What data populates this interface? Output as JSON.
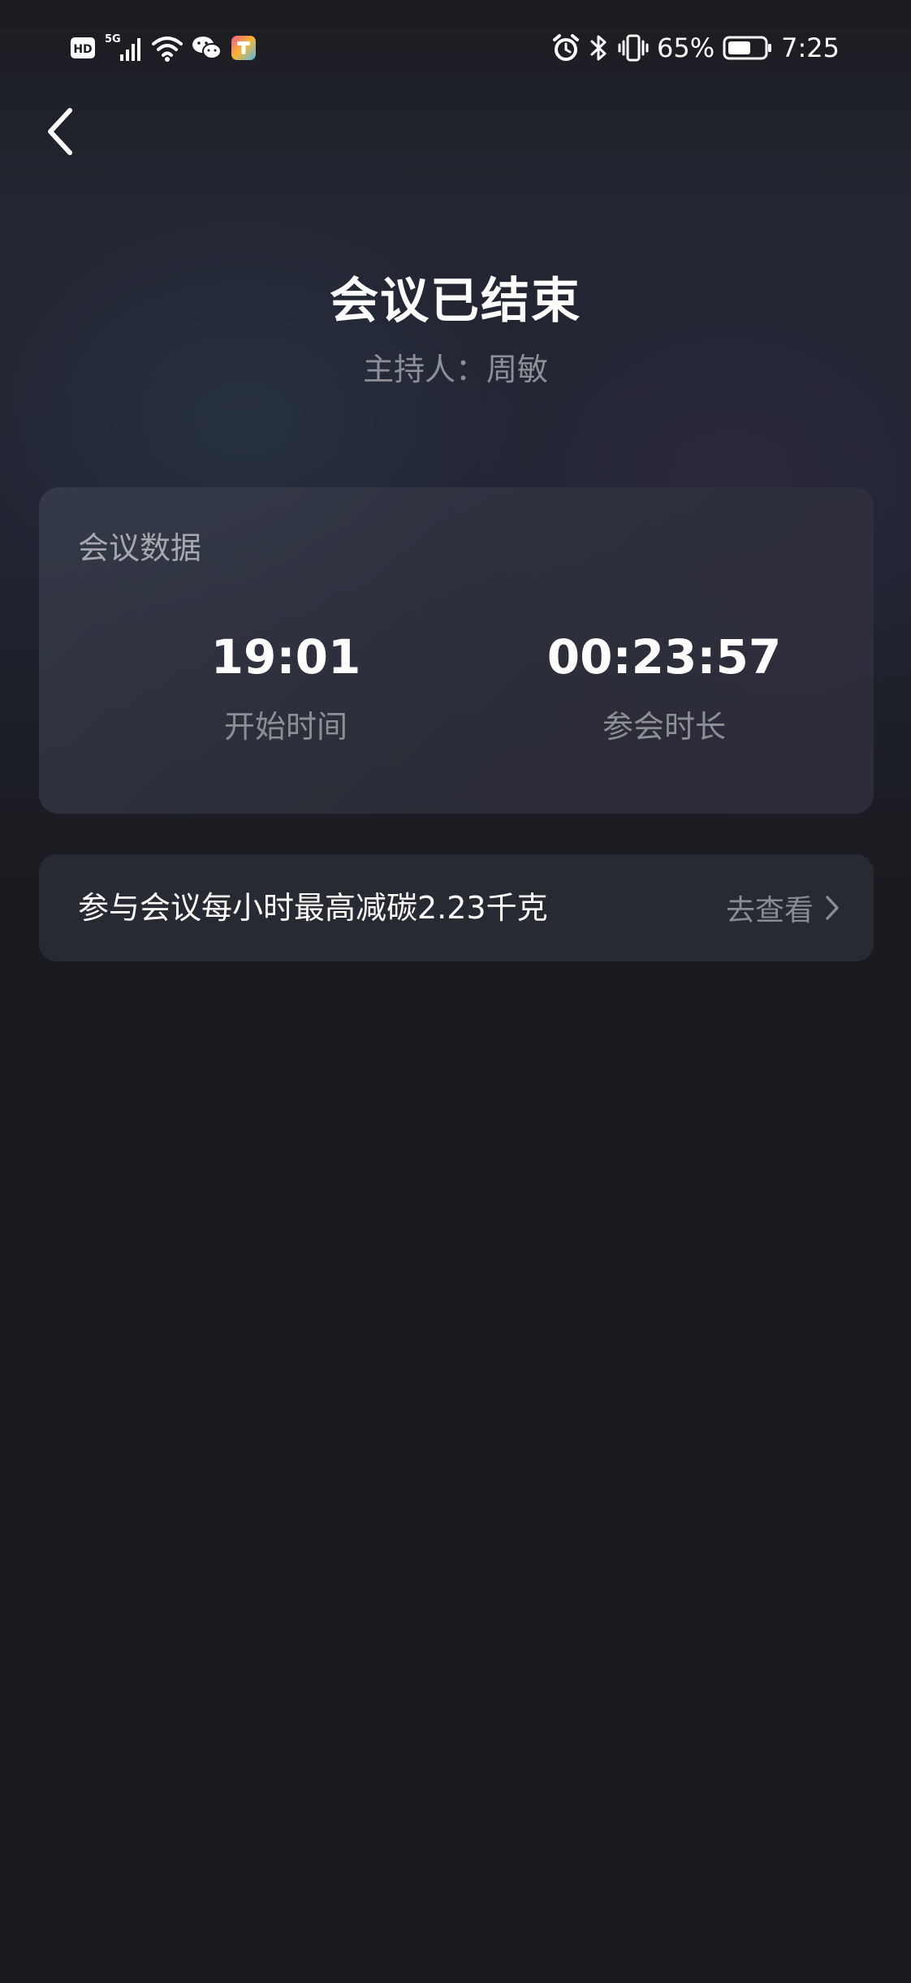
{
  "status_bar": {
    "hd_label": "HD",
    "network_label": "5G",
    "battery_percent": "65%",
    "time": "7:25",
    "icons": [
      "hd-icon",
      "signal-icon",
      "wifi-icon",
      "wechat-icon",
      "app-icon",
      "alarm-icon",
      "bluetooth-icon",
      "vibrate-icon",
      "battery-icon"
    ],
    "battery_level": 0.65
  },
  "header": {
    "title": "会议已结束",
    "host": "主持人：周敏"
  },
  "meeting_data": {
    "card_title": "会议数据",
    "start_time": {
      "value": "19:01",
      "label": "开始时间"
    },
    "duration": {
      "value": "00:23:57",
      "label": "参会时长"
    }
  },
  "carbon": {
    "text": "参与会议每小时最高减碳2.23千克",
    "link_label": "去查看"
  },
  "colors": {
    "background": "#1a1b1f",
    "card": "#282a33",
    "secondary_text": "#8e9097"
  }
}
